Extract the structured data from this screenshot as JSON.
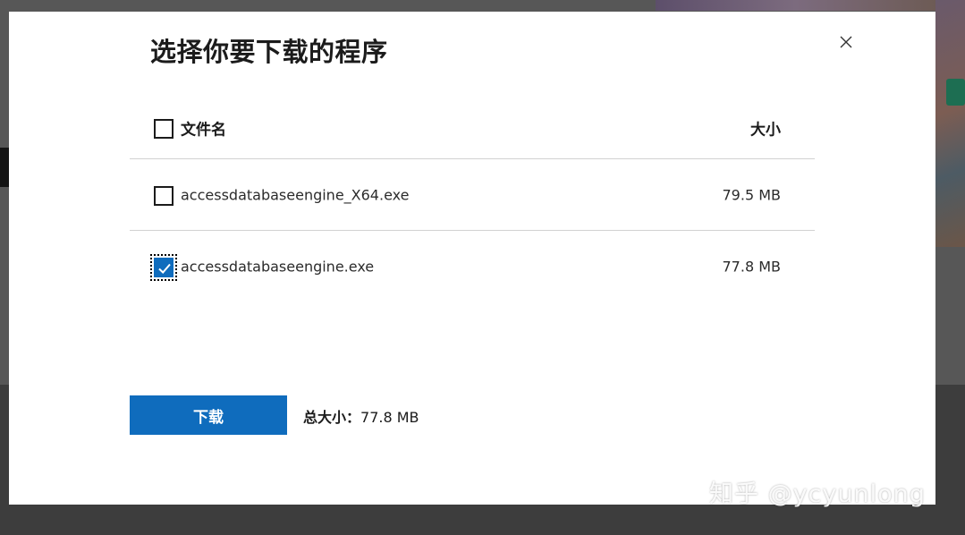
{
  "dialog": {
    "title": "选择你要下载的程序",
    "close_icon": "close-icon"
  },
  "table": {
    "header": {
      "name_label": "文件名",
      "size_label": "大小",
      "select_all_checked": false
    },
    "rows": [
      {
        "name": "accessdatabaseengine_X64.exe",
        "size": "79.5 MB",
        "checked": false
      },
      {
        "name": "accessdatabaseengine.exe",
        "size": "77.8 MB",
        "checked": true
      }
    ]
  },
  "footer": {
    "download_label": "下载",
    "total_label": "总大小：",
    "total_value": "77.8 MB"
  },
  "watermark": "知乎 @ycyunlong",
  "colors": {
    "accent": "#0f6cbd",
    "overlay": "#575757"
  }
}
